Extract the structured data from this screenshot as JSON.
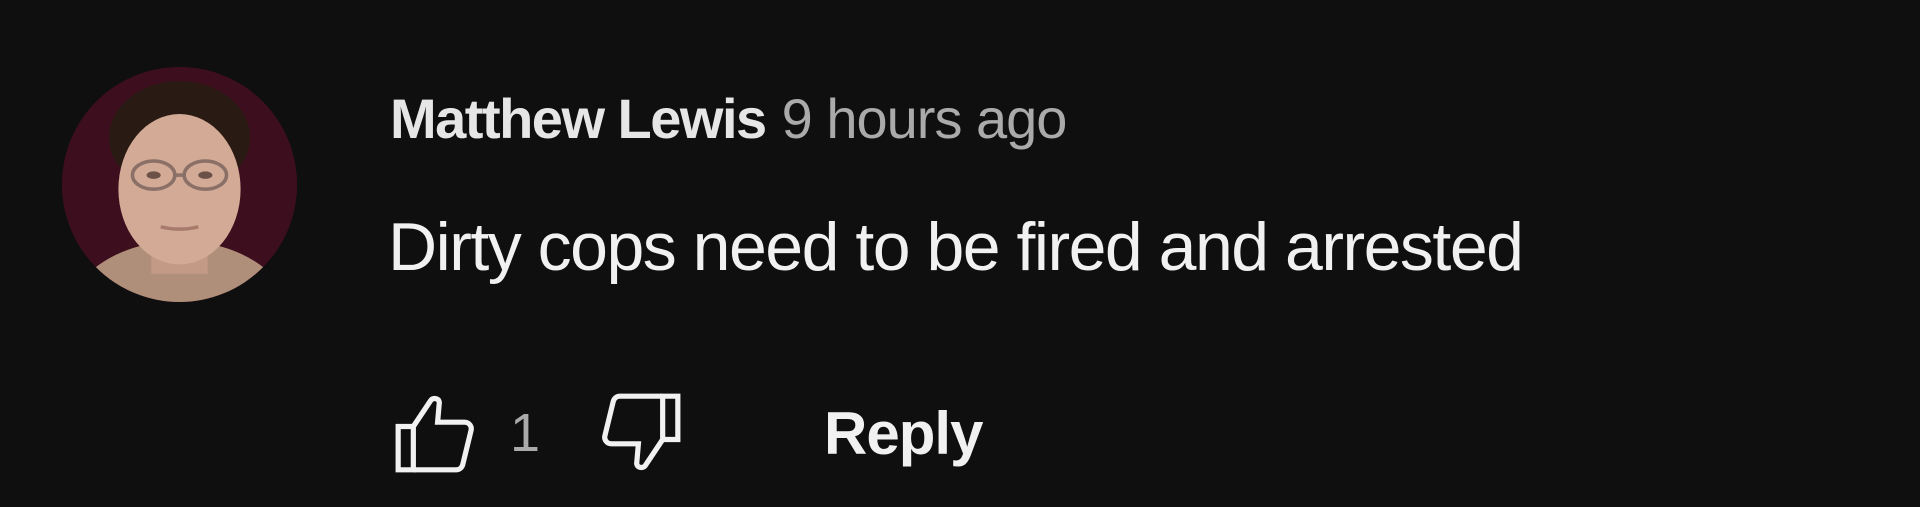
{
  "comment": {
    "author": "Matthew Lewis",
    "timestamp": "9 hours ago",
    "text": "Dirty cops need to be fired and arrested",
    "avatar_icon": "user-avatar",
    "actions": {
      "like_icon": "thumbs-up-icon",
      "like_count": "1",
      "dislike_icon": "thumbs-down-icon",
      "reply_label": "Reply"
    }
  },
  "colors": {
    "background": "#0f0f0f",
    "author_text": "#e6e6e6",
    "secondary_text": "#aaaaaa",
    "primary_text": "#f1f1f1"
  }
}
